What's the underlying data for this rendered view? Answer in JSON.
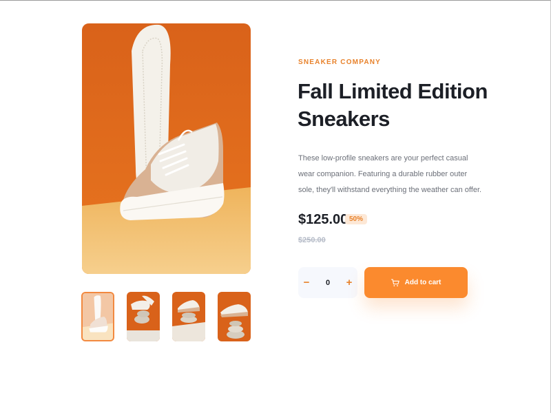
{
  "product": {
    "company": "SNEAKER COMPANY",
    "title": "Fall Limited Edition Sneakers",
    "description": "These low-profile sneakers are your perfect casual wear companion. Featuring a durable rubber outer sole, they'll withstand everything the weather can offer.",
    "price": "$125.00",
    "discount": "50%",
    "original_price": "$250.00"
  },
  "gallery": {
    "thumbnail_count": 4,
    "active_thumbnail": 1
  },
  "cart": {
    "quantity": "0",
    "decrement_symbol": "−",
    "increment_symbol": "+",
    "add_label": "Add to cart"
  },
  "icons": {
    "cart": "cart-icon",
    "minus": "minus-icon",
    "plus": "plus-icon"
  },
  "colors": {
    "accent": "#fb8a2e",
    "accent_text": "#e8822b",
    "accent_pale": "#fde8d6",
    "dark_text": "#1c1f26",
    "muted_text": "#6b6f78",
    "strike_text": "#b6bcc8",
    "stepper_bg": "#f6f8fd"
  }
}
